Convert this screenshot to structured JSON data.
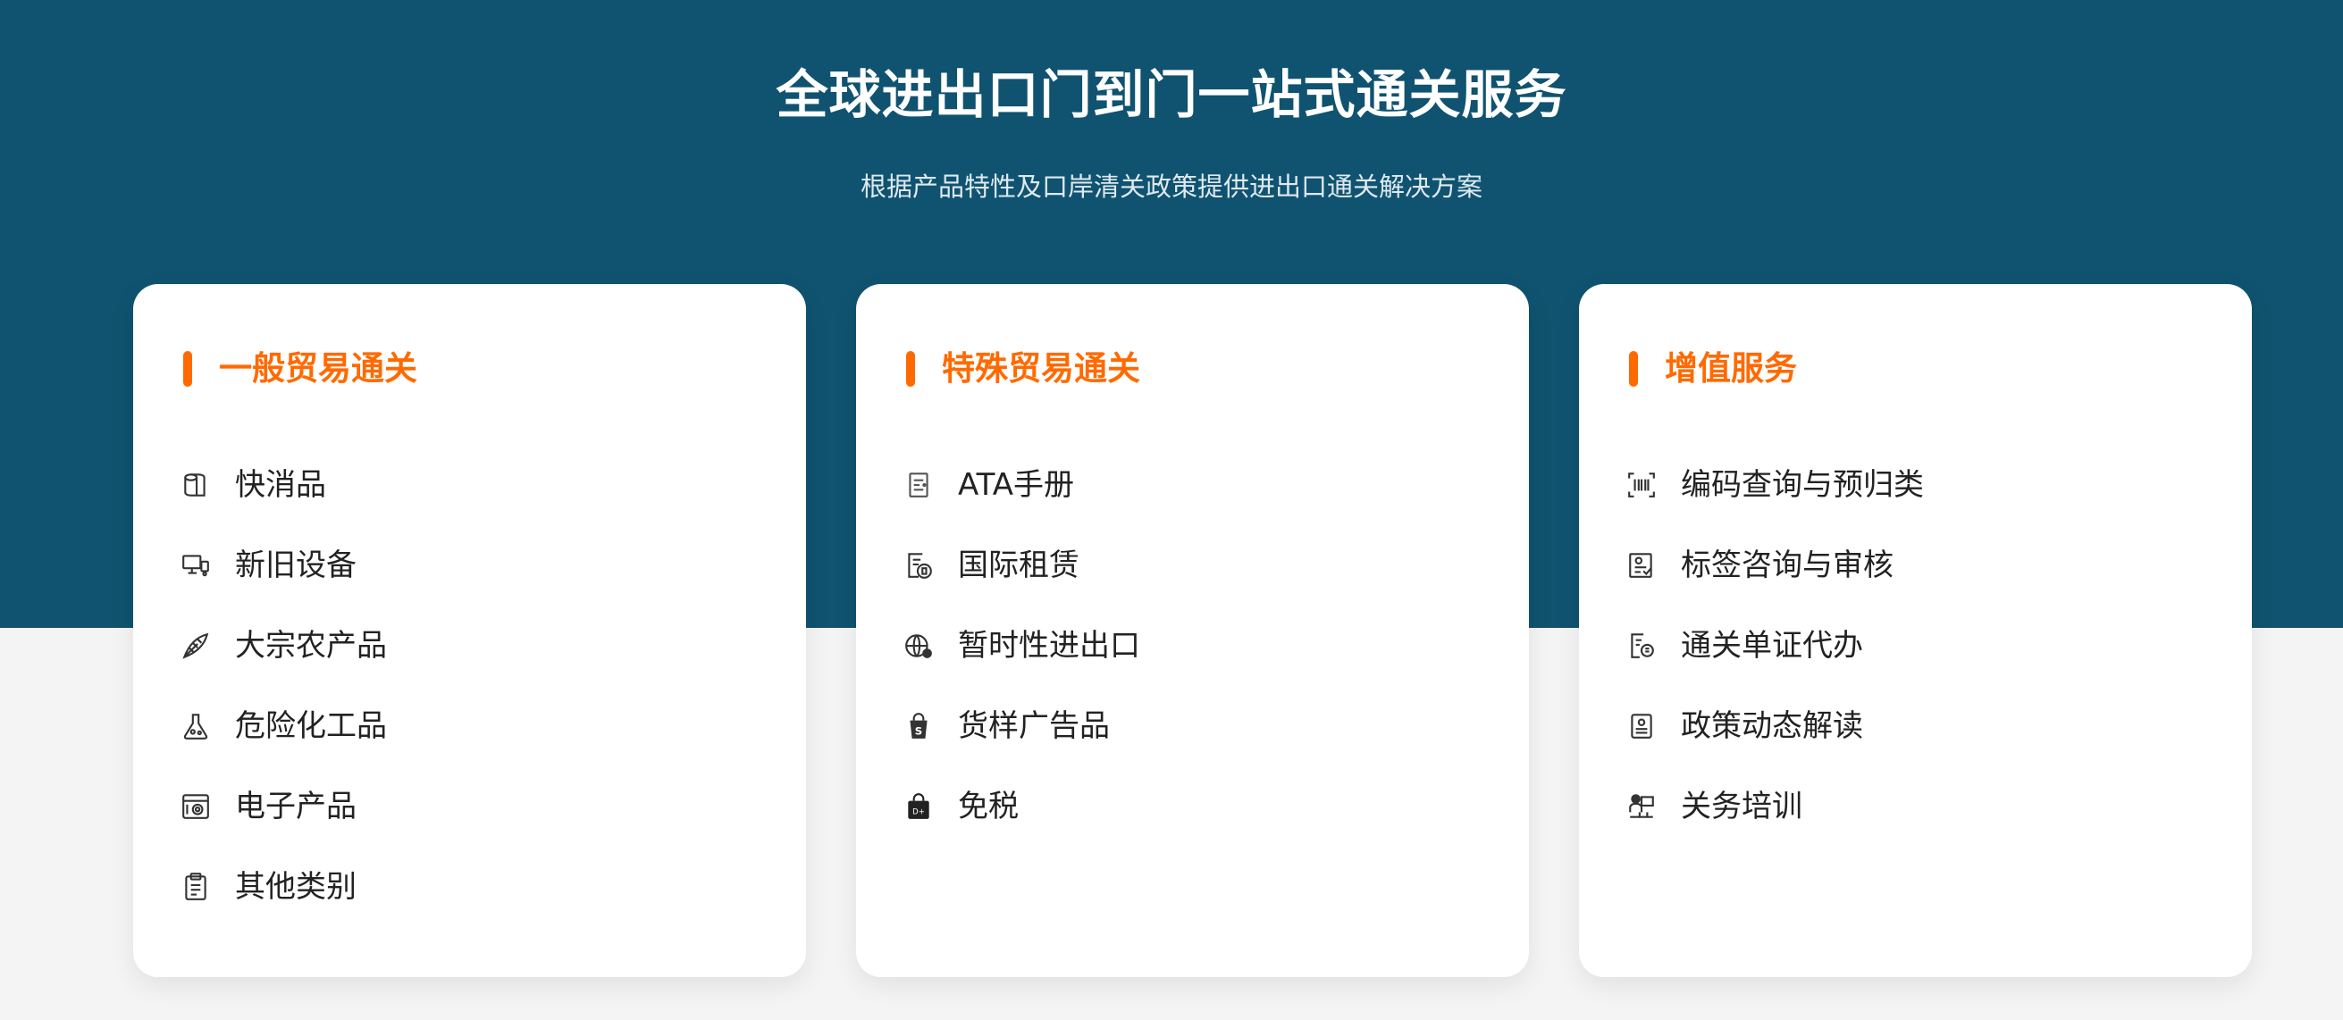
{
  "header": {
    "title": "全球进出口门到门一站式通关服务",
    "subtitle": "根据产品特性及口岸清关政策提供进出口通关解决方案"
  },
  "cards": [
    {
      "title": "一般贸易通关",
      "items": [
        {
          "label": "快消品",
          "icon": "paper-roll-icon"
        },
        {
          "label": "新旧设备",
          "icon": "devices-icon"
        },
        {
          "label": "大宗农产品",
          "icon": "leaf-icon"
        },
        {
          "label": "危险化工品",
          "icon": "flask-icon"
        },
        {
          "label": "电子产品",
          "icon": "electronics-icon"
        },
        {
          "label": "其他类别",
          "icon": "clipboard-icon"
        }
      ]
    },
    {
      "title": "特殊贸易通关",
      "items": [
        {
          "label": "ATA手册",
          "icon": "booklet-icon"
        },
        {
          "label": "国际租赁",
          "icon": "lease-document-icon"
        },
        {
          "label": "暂时性进出口",
          "icon": "globe-icon"
        },
        {
          "label": "货样广告品",
          "icon": "shopping-bag-icon"
        },
        {
          "label": "免税",
          "icon": "duty-free-bag-icon"
        }
      ]
    },
    {
      "title": "增值服务",
      "items": [
        {
          "label": "编码查询与预归类",
          "icon": "barcode-scan-icon"
        },
        {
          "label": "标签咨询与审核",
          "icon": "label-review-icon"
        },
        {
          "label": "通关单证代办",
          "icon": "document-stamp-icon"
        },
        {
          "label": "政策动态解读",
          "icon": "policy-icon"
        },
        {
          "label": "关务培训",
          "icon": "training-icon"
        }
      ]
    }
  ],
  "colors": {
    "hero_background": "#0f5370",
    "accent": "#ff6a00",
    "page_background": "#f4f4f4"
  }
}
